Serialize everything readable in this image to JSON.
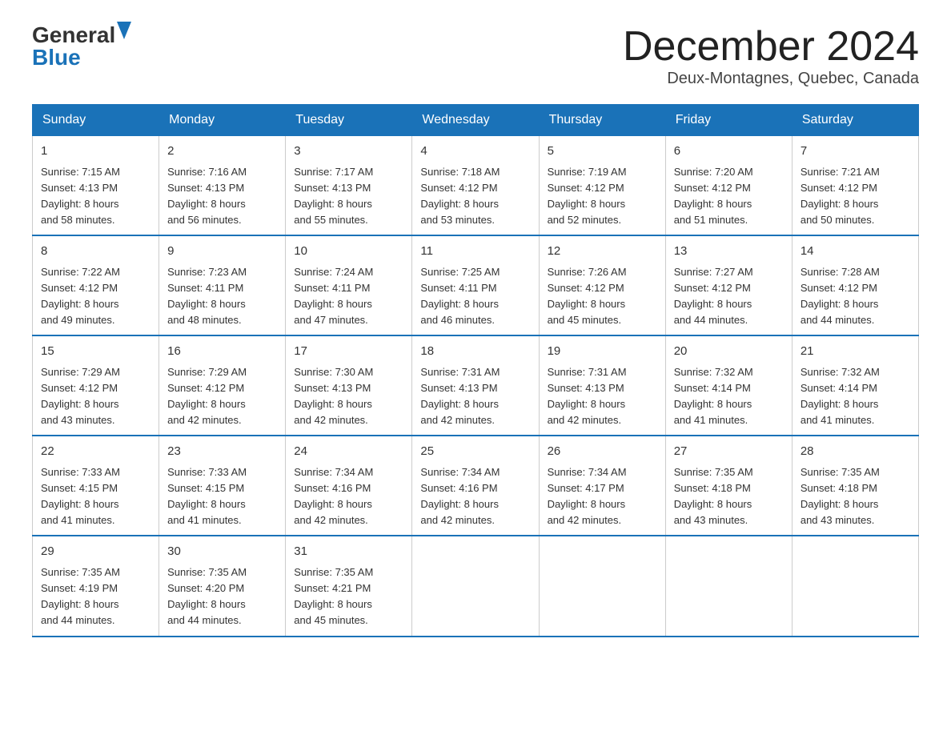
{
  "logo": {
    "general": "General",
    "blue": "Blue"
  },
  "title": "December 2024",
  "location": "Deux-Montagnes, Quebec, Canada",
  "days_of_week": [
    "Sunday",
    "Monday",
    "Tuesday",
    "Wednesday",
    "Thursday",
    "Friday",
    "Saturday"
  ],
  "weeks": [
    [
      {
        "day": "1",
        "sunrise": "7:15 AM",
        "sunset": "4:13 PM",
        "daylight": "8 hours and 58 minutes."
      },
      {
        "day": "2",
        "sunrise": "7:16 AM",
        "sunset": "4:13 PM",
        "daylight": "8 hours and 56 minutes."
      },
      {
        "day": "3",
        "sunrise": "7:17 AM",
        "sunset": "4:13 PM",
        "daylight": "8 hours and 55 minutes."
      },
      {
        "day": "4",
        "sunrise": "7:18 AM",
        "sunset": "4:12 PM",
        "daylight": "8 hours and 53 minutes."
      },
      {
        "day": "5",
        "sunrise": "7:19 AM",
        "sunset": "4:12 PM",
        "daylight": "8 hours and 52 minutes."
      },
      {
        "day": "6",
        "sunrise": "7:20 AM",
        "sunset": "4:12 PM",
        "daylight": "8 hours and 51 minutes."
      },
      {
        "day": "7",
        "sunrise": "7:21 AM",
        "sunset": "4:12 PM",
        "daylight": "8 hours and 50 minutes."
      }
    ],
    [
      {
        "day": "8",
        "sunrise": "7:22 AM",
        "sunset": "4:12 PM",
        "daylight": "8 hours and 49 minutes."
      },
      {
        "day": "9",
        "sunrise": "7:23 AM",
        "sunset": "4:11 PM",
        "daylight": "8 hours and 48 minutes."
      },
      {
        "day": "10",
        "sunrise": "7:24 AM",
        "sunset": "4:11 PM",
        "daylight": "8 hours and 47 minutes."
      },
      {
        "day": "11",
        "sunrise": "7:25 AM",
        "sunset": "4:11 PM",
        "daylight": "8 hours and 46 minutes."
      },
      {
        "day": "12",
        "sunrise": "7:26 AM",
        "sunset": "4:12 PM",
        "daylight": "8 hours and 45 minutes."
      },
      {
        "day": "13",
        "sunrise": "7:27 AM",
        "sunset": "4:12 PM",
        "daylight": "8 hours and 44 minutes."
      },
      {
        "day": "14",
        "sunrise": "7:28 AM",
        "sunset": "4:12 PM",
        "daylight": "8 hours and 44 minutes."
      }
    ],
    [
      {
        "day": "15",
        "sunrise": "7:29 AM",
        "sunset": "4:12 PM",
        "daylight": "8 hours and 43 minutes."
      },
      {
        "day": "16",
        "sunrise": "7:29 AM",
        "sunset": "4:12 PM",
        "daylight": "8 hours and 42 minutes."
      },
      {
        "day": "17",
        "sunrise": "7:30 AM",
        "sunset": "4:13 PM",
        "daylight": "8 hours and 42 minutes."
      },
      {
        "day": "18",
        "sunrise": "7:31 AM",
        "sunset": "4:13 PM",
        "daylight": "8 hours and 42 minutes."
      },
      {
        "day": "19",
        "sunrise": "7:31 AM",
        "sunset": "4:13 PM",
        "daylight": "8 hours and 42 minutes."
      },
      {
        "day": "20",
        "sunrise": "7:32 AM",
        "sunset": "4:14 PM",
        "daylight": "8 hours and 41 minutes."
      },
      {
        "day": "21",
        "sunrise": "7:32 AM",
        "sunset": "4:14 PM",
        "daylight": "8 hours and 41 minutes."
      }
    ],
    [
      {
        "day": "22",
        "sunrise": "7:33 AM",
        "sunset": "4:15 PM",
        "daylight": "8 hours and 41 minutes."
      },
      {
        "day": "23",
        "sunrise": "7:33 AM",
        "sunset": "4:15 PM",
        "daylight": "8 hours and 41 minutes."
      },
      {
        "day": "24",
        "sunrise": "7:34 AM",
        "sunset": "4:16 PM",
        "daylight": "8 hours and 42 minutes."
      },
      {
        "day": "25",
        "sunrise": "7:34 AM",
        "sunset": "4:16 PM",
        "daylight": "8 hours and 42 minutes."
      },
      {
        "day": "26",
        "sunrise": "7:34 AM",
        "sunset": "4:17 PM",
        "daylight": "8 hours and 42 minutes."
      },
      {
        "day": "27",
        "sunrise": "7:35 AM",
        "sunset": "4:18 PM",
        "daylight": "8 hours and 43 minutes."
      },
      {
        "day": "28",
        "sunrise": "7:35 AM",
        "sunset": "4:18 PM",
        "daylight": "8 hours and 43 minutes."
      }
    ],
    [
      {
        "day": "29",
        "sunrise": "7:35 AM",
        "sunset": "4:19 PM",
        "daylight": "8 hours and 44 minutes."
      },
      {
        "day": "30",
        "sunrise": "7:35 AM",
        "sunset": "4:20 PM",
        "daylight": "8 hours and 44 minutes."
      },
      {
        "day": "31",
        "sunrise": "7:35 AM",
        "sunset": "4:21 PM",
        "daylight": "8 hours and 45 minutes."
      },
      null,
      null,
      null,
      null
    ]
  ],
  "labels": {
    "sunrise": "Sunrise:",
    "sunset": "Sunset:",
    "daylight": "Daylight:"
  }
}
